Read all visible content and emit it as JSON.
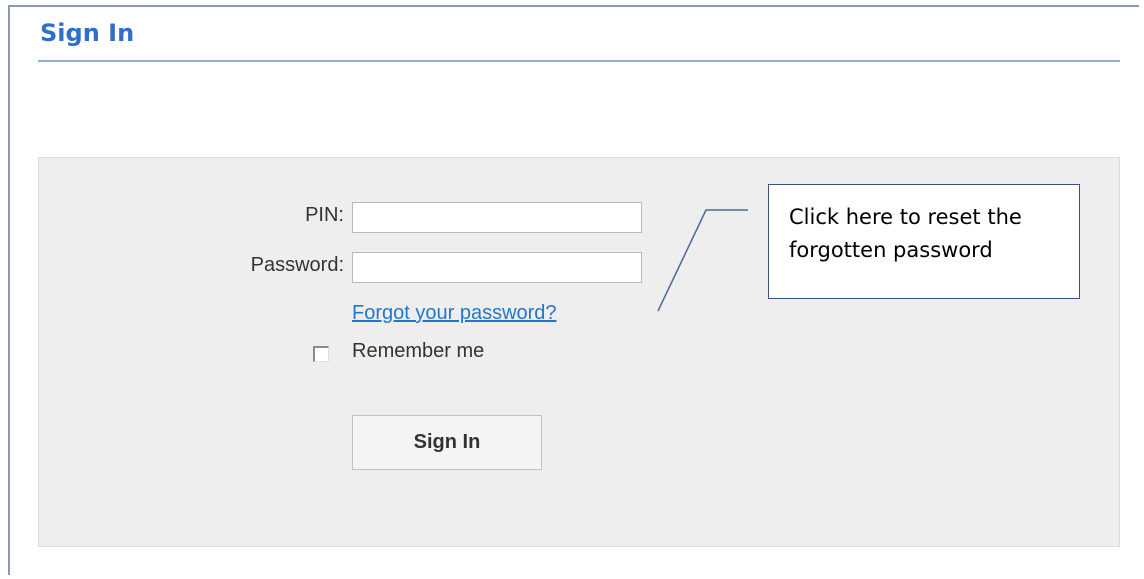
{
  "header": {
    "title": "Sign In"
  },
  "form": {
    "pin_label": "PIN:",
    "pin_value": "",
    "password_label": "Password:",
    "password_value": "",
    "forgot_link": "Forgot your password?",
    "remember_label": "Remember me",
    "remember_checked": false,
    "submit_label": "Sign In"
  },
  "callout": {
    "line1": "Click here to reset the",
    "line2": "forgotten password"
  },
  "colors": {
    "title": "#2f6fc9",
    "link": "#2277cc",
    "panel": "#eeeeee"
  }
}
